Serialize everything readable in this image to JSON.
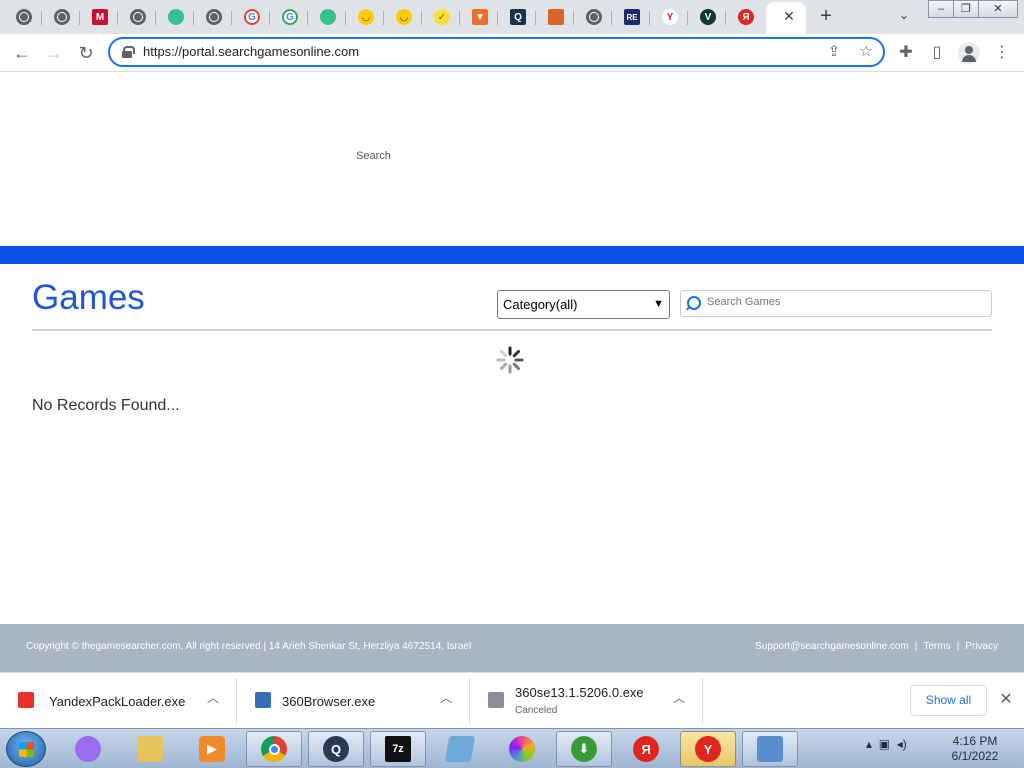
{
  "browser": {
    "tabs": [
      {
        "icon": "globe-icon"
      },
      {
        "icon": "globe-icon"
      },
      {
        "icon": "m-logo-icon"
      },
      {
        "icon": "globe-icon"
      },
      {
        "icon": "green-leaf-icon"
      },
      {
        "icon": "globe-icon"
      },
      {
        "icon": "google-g-icon"
      },
      {
        "icon": "google-g-icon"
      },
      {
        "icon": "green-leaf-icon"
      },
      {
        "icon": "yellow-smile-icon"
      },
      {
        "icon": "yellow-smile-icon"
      },
      {
        "icon": "yellow-check-icon"
      },
      {
        "icon": "orange-shield-icon"
      },
      {
        "icon": "q-logo-icon"
      },
      {
        "icon": "orange-box-icon"
      },
      {
        "icon": "globe-icon"
      },
      {
        "icon": "re-logo-icon"
      },
      {
        "icon": "y-logo-icon"
      },
      {
        "icon": "v-logo-icon"
      },
      {
        "icon": "yandex-icon"
      }
    ],
    "tab_close": "✕",
    "new_tab": "+",
    "url": "https://portal.searchgamesonline.com"
  },
  "page": {
    "top_search_label": "Search",
    "title": "Games",
    "category_select": "Category(all)",
    "search_placeholder": "Search Games",
    "no_records": "No Records Found..."
  },
  "footer": {
    "copyright": "Copyright © thegamesearcher.com, All right reserved | 14 Arieh Shenkar St, Herzliya 4672514, Israel",
    "support": "Support@searchgamesonline.com",
    "sep": "|",
    "terms": "Terms",
    "privacy": "Privacy"
  },
  "downloads": [
    {
      "name": "YandexPackLoader.exe",
      "status": "",
      "icon_color": "#e8302a"
    },
    {
      "name": "360Browser.exe",
      "status": "",
      "icon_color": "#3a6bb5"
    },
    {
      "name": "360se13.1.5206.0.exe",
      "status": "Canceled",
      "icon_color": "#8a8f96"
    }
  ],
  "download_shelf": {
    "show_all": "Show all",
    "close": "✕"
  },
  "taskbar": {
    "apps": [
      {
        "name": "alice-icon",
        "color": "#9b6cf0",
        "glyph": ""
      },
      {
        "name": "file-explorer-icon",
        "color": "#e8c25a",
        "glyph": ""
      },
      {
        "name": "media-player-icon",
        "color": "#f08a2a",
        "glyph": "▶"
      },
      {
        "name": "chrome-icon",
        "color": "#db4437",
        "glyph": ""
      },
      {
        "name": "q-app-icon",
        "color": "#2b3a55",
        "glyph": "Q"
      },
      {
        "name": "7zip-icon",
        "color": "#111111",
        "glyph": "7z"
      },
      {
        "name": "notepad-icon",
        "color": "#6fa9d8",
        "glyph": ""
      },
      {
        "name": "color-wheel-icon",
        "color": "#e94b8a",
        "glyph": ""
      },
      {
        "name": "download-arrow-icon",
        "color": "#3a9a3a",
        "glyph": "⬇"
      },
      {
        "name": "yandex-app-icon",
        "color": "#e0261f",
        "glyph": "Я"
      },
      {
        "name": "yandex-browser-icon",
        "color": "#e0261f",
        "glyph": "Y"
      },
      {
        "name": "control-panel-icon",
        "color": "#5a8fcf",
        "glyph": ""
      }
    ],
    "time": "4:16 PM",
    "date": "6/1/2022"
  }
}
